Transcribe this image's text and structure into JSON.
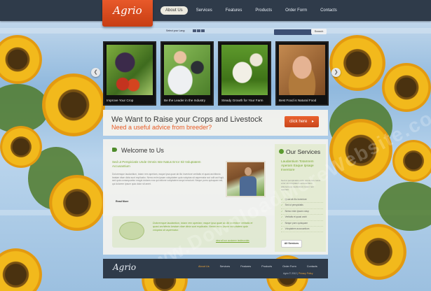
{
  "logo": "Agrio",
  "nav": [
    "About Us",
    "Services",
    "Features",
    "Products",
    "Order Form",
    "Contacts"
  ],
  "search": {
    "lang_label": "Select your Lang:",
    "button": "Search",
    "placeholder": ""
  },
  "gallery": [
    {
      "caption": "Improve Your Crop"
    },
    {
      "caption": "Be the Leader in the Industry"
    },
    {
      "caption": "Steady Growth for Your Farm"
    },
    {
      "caption": "Best Food is Natural Food"
    }
  ],
  "banner": {
    "title": "We Want to Raise your Crops and Livestock",
    "subtitle": "Need a useful advice from breeder?",
    "button": "click here"
  },
  "welcome": {
    "title": "Welcome to Us",
    "intro": "Sed ut Perspiciatis Unde Omnis Iste Natus Error Sit Voluptatem Accusantium",
    "paragraph": "Doloremque laudantium, totam rem aperiam, eaque ipsa quae ab illo inventore veritatis et quasi architecto beatae vitae dicta sunt explicabo. Nemo enim ipsam voluptatem quia voluptas sit aspernatur aut odit aut fugit, sed quia consequuntur magni dolores eos qui ratione voluptatem sequi nesciunt. Neque porro quisquam est, qui dolorem ipsum quia dolor sit amet.",
    "read_more": "Read More"
  },
  "quote": {
    "text": "Doloremque laudantium, totam rem aperiam, eaque ipsa quae ab illo inventore veritatis et quasi architecto beatae vitae dicta sunt explicabo. Nemo enim ipsam voluptatem quia voluptas sit aspernatur.",
    "link": "view all our customer testimonials"
  },
  "services": {
    "title": "Our Services",
    "headline": "Laudantium Totamrem Aperam Eaque Ipsaqe Inventore",
    "paragraph": "Sed ut perspiciatis unde omnis iste natus error sit voluptatem accusantium doloremque laudantium totam rem aperiam.",
    "items": [
      "Quae ab illo inventore",
      "Sed ut perspiciatis",
      "Nemo enim ipsam volup",
      "Veritatis et quasi archi",
      "Neque porro quisquam",
      "Voluptatem accusantium"
    ],
    "button": "All Services"
  },
  "footer": {
    "logo": "Agrio",
    "nav": [
      "About Us",
      "Services",
      "Features",
      "Products",
      "Order Form",
      "Contacts"
    ],
    "copyright": "Agrio © 2012 |",
    "privacy": "Privacy Policy"
  },
  "watermark": "www.DownloadMoreWebsite.com"
}
